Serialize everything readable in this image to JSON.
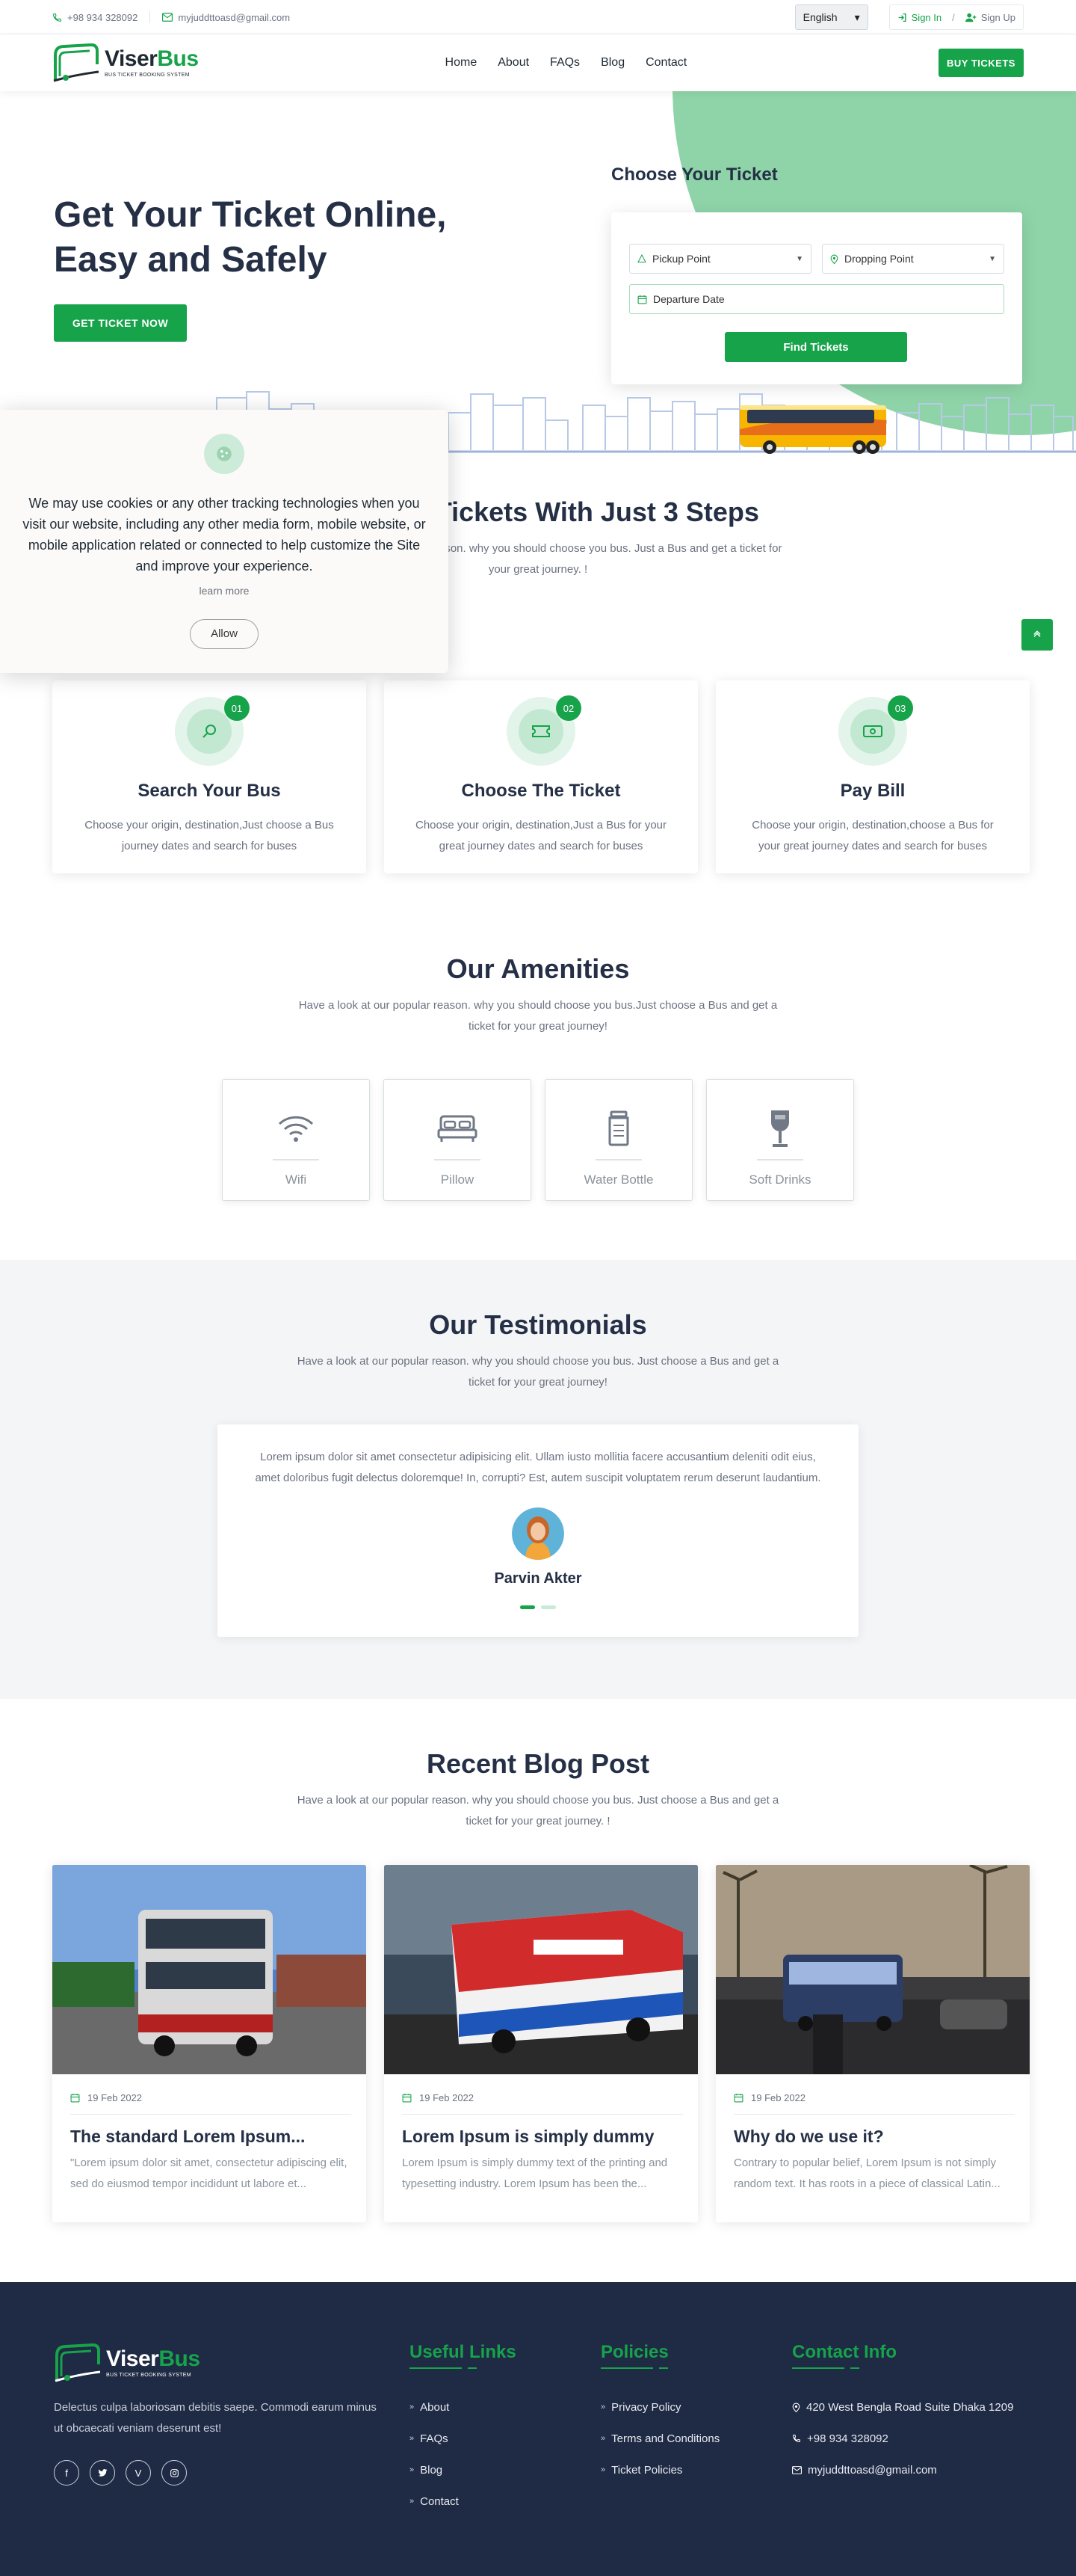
{
  "topbar": {
    "phone": "+98 934 328092",
    "email": "myjuddttoasd@gmail.com",
    "language": "English",
    "sign_in": "Sign In",
    "separator": "/",
    "sign_up": "Sign Up"
  },
  "brand": {
    "name_part1": "Viser",
    "name_part2": "Bus",
    "tagline": "BUS TICKET BOOKING SYSTEM",
    "accent": "#16a34a",
    "light_green": "#8fd4a9",
    "footer_bg": "#1f2a44"
  },
  "nav": {
    "items": [
      "Home",
      "About",
      "FAQs",
      "Blog",
      "Contact"
    ],
    "buy_tickets": "BUY TICKETS"
  },
  "hero": {
    "headline_line1": "Get Your Ticket Online,",
    "headline_line2": "Easy and Safely",
    "cta": "GET TICKET NOW",
    "form_title": "Choose Your Ticket",
    "pickup": "Pickup Point",
    "dropping": "Dropping Point",
    "departure": "Departure Date",
    "find": "Find Tickets"
  },
  "cookie": {
    "message": "We may use cookies or any other tracking technologies when you visit our website, including any other media form, mobile website, or mobile application related or connected to help customize the Site and improve your experience.",
    "learn_more": "learn more",
    "allow": "Allow"
  },
  "steps": {
    "title": "Get Your Tickets With Just 3 Steps",
    "subtitle": "Have a look at our popular reason. why you should choose you bus. Just a Bus and get a ticket for your great journey. !",
    "cards": [
      {
        "badge": "01",
        "title": "Search Your Bus",
        "text": "Choose your origin, destination,Just choose a Bus journey dates and search for buses"
      },
      {
        "badge": "02",
        "title": "Choose The Ticket",
        "text": "Choose your origin, destination,Just a Bus for your great journey dates and search for buses"
      },
      {
        "badge": "03",
        "title": "Pay Bill",
        "text": "Choose your origin, destination,choose a Bus for your great journey dates and search for buses"
      }
    ]
  },
  "amenities": {
    "title": "Our Amenities",
    "subtitle": "Have a look at our popular reason. why you should choose you bus.Just choose a Bus and get a ticket for your great journey!",
    "items": [
      {
        "label": "Wifi",
        "icon": "wifi-icon"
      },
      {
        "label": "Pillow",
        "icon": "bed-icon"
      },
      {
        "label": "Water Bottle",
        "icon": "bottle-icon"
      },
      {
        "label": "Soft Drinks",
        "icon": "glass-icon"
      }
    ]
  },
  "testimonials": {
    "title": "Our Testimonials",
    "subtitle": "Have a look at our popular reason. why you should choose you bus. Just choose a Bus and get a ticket for your great journey!",
    "quote": "Lorem ipsum dolor sit amet consectetur adipisicing elit. Ullam iusto mollitia facere accusantium deleniti odit eius, amet doloribus fugit delectus doloremque! In, corrupti? Est, autem suscipit voluptatem rerum deserunt laudantium.",
    "name": "Parvin Akter"
  },
  "blog": {
    "title": "Recent Blog Post",
    "subtitle": "Have a look at our popular reason. why you should choose you bus. Just choose a Bus and get a ticket for your great journey. !",
    "posts": [
      {
        "date": "19 Feb 2022",
        "title": "The standard Lorem Ipsum...",
        "excerpt": "\"Lorem ipsum dolor sit amet, consectetur adipiscing elit, sed do eiusmod tempor incididunt ut labore et..."
      },
      {
        "date": "19 Feb 2022",
        "title": "Lorem Ipsum is simply dummy",
        "excerpt": "Lorem Ipsum is simply dummy text of the printing and typesetting industry. Lorem Ipsum has been the..."
      },
      {
        "date": "19 Feb 2022",
        "title": "Why do we use it?",
        "excerpt": "Contrary to popular belief, Lorem Ipsum is not simply random text. It has roots in a piece of classical Latin..."
      }
    ]
  },
  "footer": {
    "about": "Delectus culpa laboriosam debitis saepe. Commodi earum minus ut obcaecati veniam deserunt est!",
    "useful_title": "Useful Links",
    "useful_links": [
      "About",
      "FAQs",
      "Blog",
      "Contact"
    ],
    "policies_title": "Policies",
    "policies": [
      "Privacy Policy",
      "Terms and Conditions",
      "Ticket Policies"
    ],
    "contact_title": "Contact Info",
    "address": "420 West Bengla Road Suite Dhaka 1209",
    "phone": "+98 934 328092",
    "email": "myjuddttoasd@gmail.com"
  }
}
